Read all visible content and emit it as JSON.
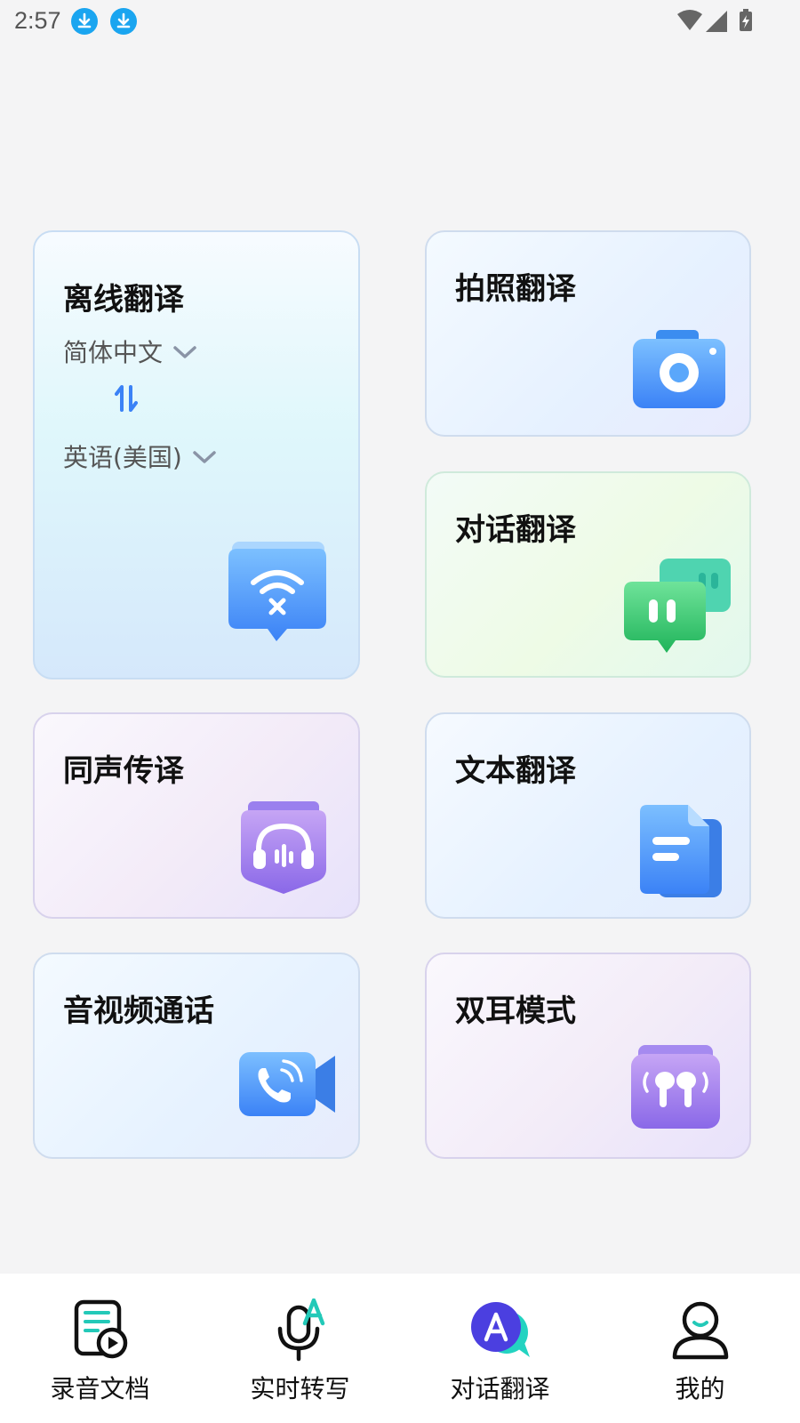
{
  "status_bar": {
    "time": "2:57"
  },
  "cards": {
    "offline": {
      "title": "离线翻译",
      "source_lang": "简体中文",
      "target_lang": "英语(美国)"
    },
    "photo": {
      "title": "拍照翻译"
    },
    "conversation": {
      "title": "对话翻译"
    },
    "simultaneous": {
      "title": "同声传译"
    },
    "text": {
      "title": "文本翻译"
    },
    "av_call": {
      "title": "音视频通话"
    },
    "earbuds": {
      "title": "双耳模式"
    }
  },
  "tabbar": {
    "items": [
      {
        "label": "录音文档",
        "icon": "document-play-icon"
      },
      {
        "label": "实时转写",
        "icon": "microphone-a-icon"
      },
      {
        "label": "对话翻译",
        "icon": "chat-translate-icon",
        "active": true
      },
      {
        "label": "我的",
        "icon": "profile-icon"
      }
    ]
  },
  "colors": {
    "accent_blue": "#3b82f6",
    "accent_green": "#22c55e",
    "accent_purple": "#8b5cf6",
    "download_badge": "#1aa5f0"
  }
}
